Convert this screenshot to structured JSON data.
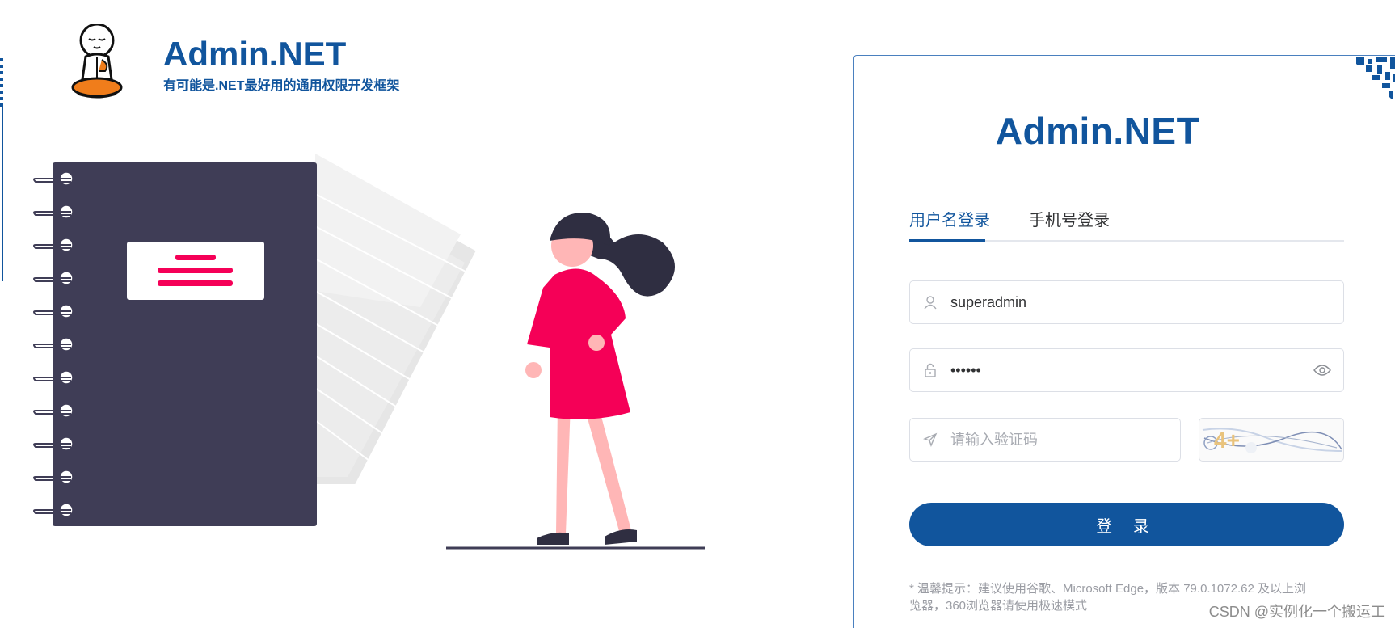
{
  "brand": {
    "title": "Admin.NET",
    "subtitle": "有可能是.NET最好用的通用权限开发框架"
  },
  "card": {
    "title": "Admin.NET",
    "tabs": [
      {
        "label": "用户名登录",
        "active": true
      },
      {
        "label": "手机号登录",
        "active": false
      }
    ],
    "username": {
      "value": "superadmin",
      "icon": "user-icon"
    },
    "password": {
      "value": "••••••",
      "icon": "lock-icon",
      "toggle_icon": "eye-icon"
    },
    "captcha": {
      "placeholder": "请输入验证码",
      "icon": "send-icon",
      "image_text": "4+"
    },
    "login_label": "登 录",
    "tip_line1": "* 温馨提示：建议使用谷歌、Microsoft Edge，版本 79.0.1072.62 及以上浏",
    "tip_line2": "览器，360浏览器请使用极速模式"
  },
  "watermark": "CSDN @实例化一个搬运工",
  "colors": {
    "brand": "#11559d",
    "accent_pink": "#f50057",
    "notebook": "#3f3d56",
    "skin": "#ffb6b6"
  }
}
